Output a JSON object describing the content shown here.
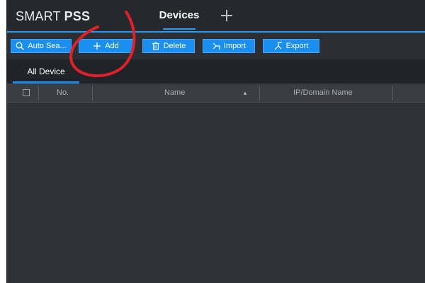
{
  "app": {
    "logo_light": "SMART",
    "logo_bold": "PSS",
    "active_tab": "Devices"
  },
  "toolbar": {
    "buttons": [
      {
        "label": "Auto Sea...",
        "icon": "search-icon"
      },
      {
        "label": "Add",
        "icon": "plus-icon"
      },
      {
        "label": "Delete",
        "icon": "trash-icon"
      },
      {
        "label": "Import",
        "icon": "import-icon"
      },
      {
        "label": "Export",
        "icon": "export-icon"
      }
    ]
  },
  "device_tabs": [
    "All Device"
  ],
  "table": {
    "columns": [
      "No.",
      "Name",
      "IP/Domain Name"
    ],
    "sort_indicator": "▲",
    "rows": []
  },
  "colors": {
    "accent": "#1a8ff0",
    "annotation": "#e0202a",
    "background": "#2f3338"
  }
}
